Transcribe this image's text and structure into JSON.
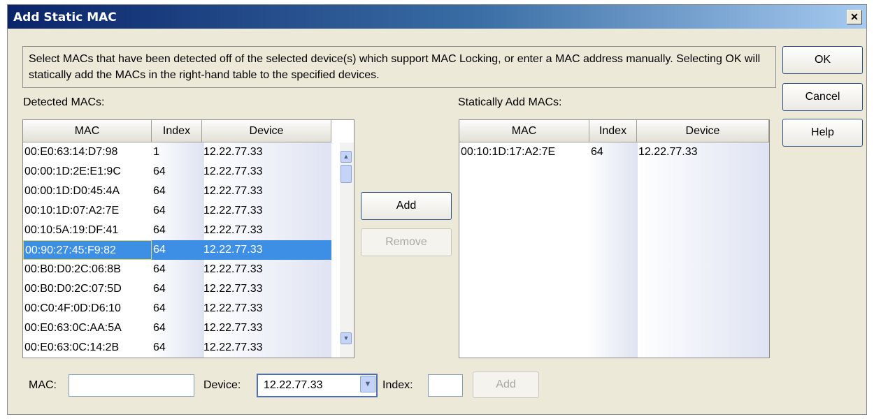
{
  "window": {
    "title": "Add Static MAC",
    "close_glyph": "✕"
  },
  "info": {
    "text": "Select MACs that have been detected off of the selected device(s) which support MAC Locking, or enter a MAC address manually. Selecting OK will statically add the MACs in the right-hand table to the specified devices."
  },
  "side_buttons": {
    "ok": "OK",
    "cancel": "Cancel",
    "help": "Help"
  },
  "detected": {
    "label": "Detected MACs:",
    "columns": [
      "MAC",
      "Index",
      "Device"
    ],
    "rows": [
      [
        "00:E0:63:14:D7:98",
        "1",
        "12.22.77.33"
      ],
      [
        "00:00:1D:2E:E1:9C",
        "64",
        "12.22.77.33"
      ],
      [
        "00:00:1D:D0:45:4A",
        "64",
        "12.22.77.33"
      ],
      [
        "00:10:1D:07:A2:7E",
        "64",
        "12.22.77.33"
      ],
      [
        "00:10:5A:19:DF:41",
        "64",
        "12.22.77.33"
      ],
      [
        "00:90:27:45:F9:82",
        "64",
        "12.22.77.33"
      ],
      [
        "00:B0:D0:2C:06:8B",
        "64",
        "12.22.77.33"
      ],
      [
        "00:B0:D0:2C:07:5D",
        "64",
        "12.22.77.33"
      ],
      [
        "00:C0:4F:0D:D6:10",
        "64",
        "12.22.77.33"
      ],
      [
        "00:E0:63:0C:AA:5A",
        "64",
        "12.22.77.33"
      ],
      [
        "00:E0:63:0C:14:2B",
        "64",
        "12.22.77.33"
      ]
    ],
    "selected_row": 5,
    "scroll_up_icon": "▲",
    "scroll_down_icon": "▼"
  },
  "middle_buttons": {
    "add": "Add",
    "remove": "Remove"
  },
  "static": {
    "label": "Statically Add MACs:",
    "columns": [
      "MAC",
      "Index",
      "Device"
    ],
    "rows": [
      [
        "00:10:1D:17:A2:7E",
        "64",
        "12.22.77.33"
      ]
    ]
  },
  "bottom": {
    "mac_label": "MAC:",
    "mac_value": "",
    "device_label": "Device:",
    "device_value": "12.22.77.33",
    "device_arrow_icon": "▼",
    "index_label": "Index:",
    "index_value": "",
    "add_label": "Add"
  },
  "colors": {
    "selection": "#3d8fe6",
    "titlebar": "#0a246a"
  }
}
